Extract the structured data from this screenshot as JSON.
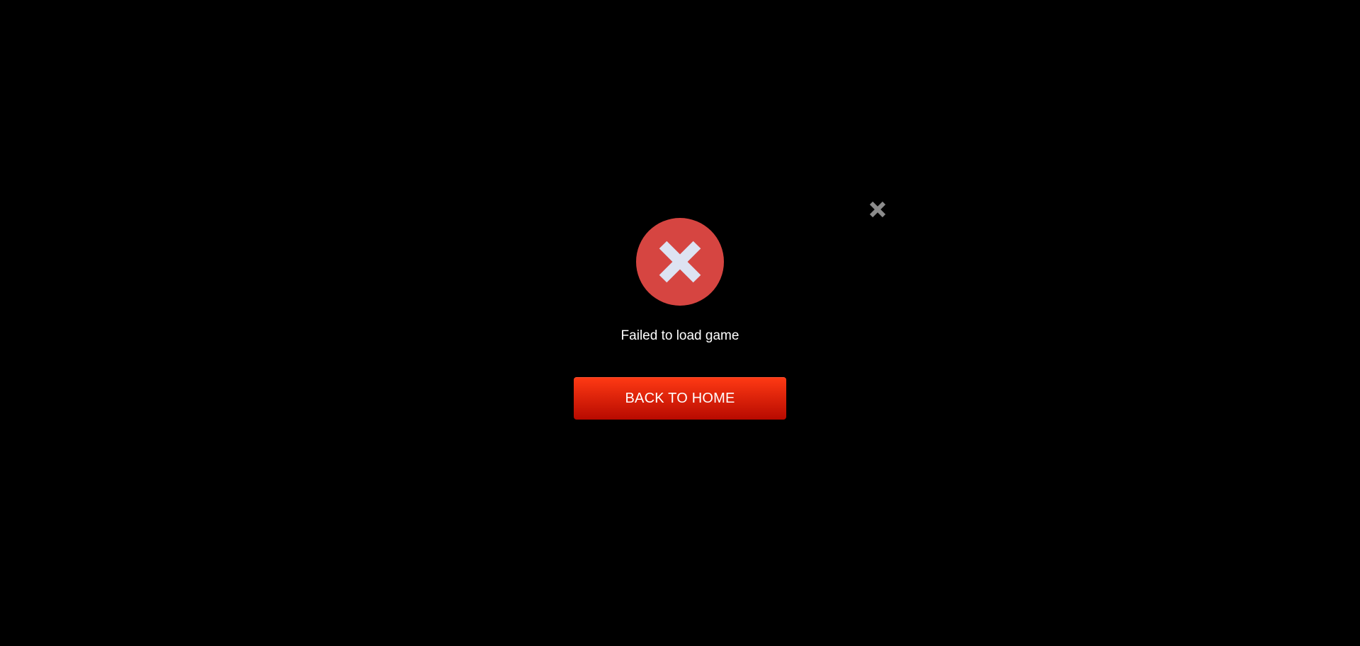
{
  "dialog": {
    "message": "Failed to load game",
    "back_button_label": "BACK TO HOME",
    "close_icon": "close-icon",
    "status_icon": "error-x-icon"
  },
  "colors": {
    "background": "#000000",
    "error_circle": "#d64541",
    "error_x": "#dde3f2",
    "close_icon": "#8c8c8c",
    "button_top": "#ff3a14",
    "button_bottom": "#b70a00",
    "text": "#ffffff"
  }
}
